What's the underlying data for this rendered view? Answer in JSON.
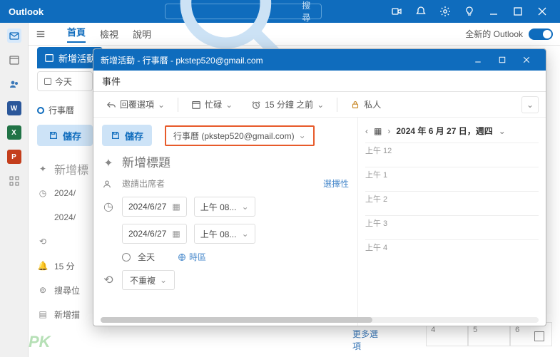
{
  "titlebar": {
    "brand": "Outlook",
    "search_placeholder": "搜尋"
  },
  "tabs": {
    "home": "首頁",
    "view": "檢視",
    "help": "說明",
    "new_outlook": "全新的 Outlook"
  },
  "rail": {
    "word": "W",
    "excel": "X",
    "ppt": "P"
  },
  "bg": {
    "new_event_tab": "新增活動",
    "today": "今天",
    "calendar": "行事曆",
    "save": "儲存",
    "new_title_trunc": "新增標",
    "date1": "2024/",
    "date2": "2024/",
    "reminder": "15 分",
    "search_loc": "搜尋位",
    "new_desc": "新增描",
    "more_options": "更多選項",
    "small1": "4",
    "small2": "5",
    "small3": "6"
  },
  "dialog": {
    "title": "新增活動 - 行事曆 - pkstep520@gmail.com",
    "sub": "事件",
    "tools": {
      "reply": "回覆選項",
      "busy": "忙碌",
      "reminder": "15 分鐘 之前",
      "private": "私人"
    },
    "save": "儲存",
    "calendar_select": "行事曆 (pkstep520@gmail.com)",
    "title_placeholder": "新增標題",
    "invite": "邀請出席者",
    "optional": "選擇性",
    "date1": "2024/6/27",
    "date2": "2024/6/27",
    "time1": "上午 08...",
    "time2": "上午 08...",
    "allday": "全天",
    "timezone": "時區",
    "repeat": "不重複",
    "right": {
      "date": "2024 年 6 月 27 日，週四",
      "slots": [
        "上午 12",
        "上午 1",
        "上午 2",
        "上午 3",
        "上午 4"
      ]
    }
  },
  "watermark": "PK"
}
